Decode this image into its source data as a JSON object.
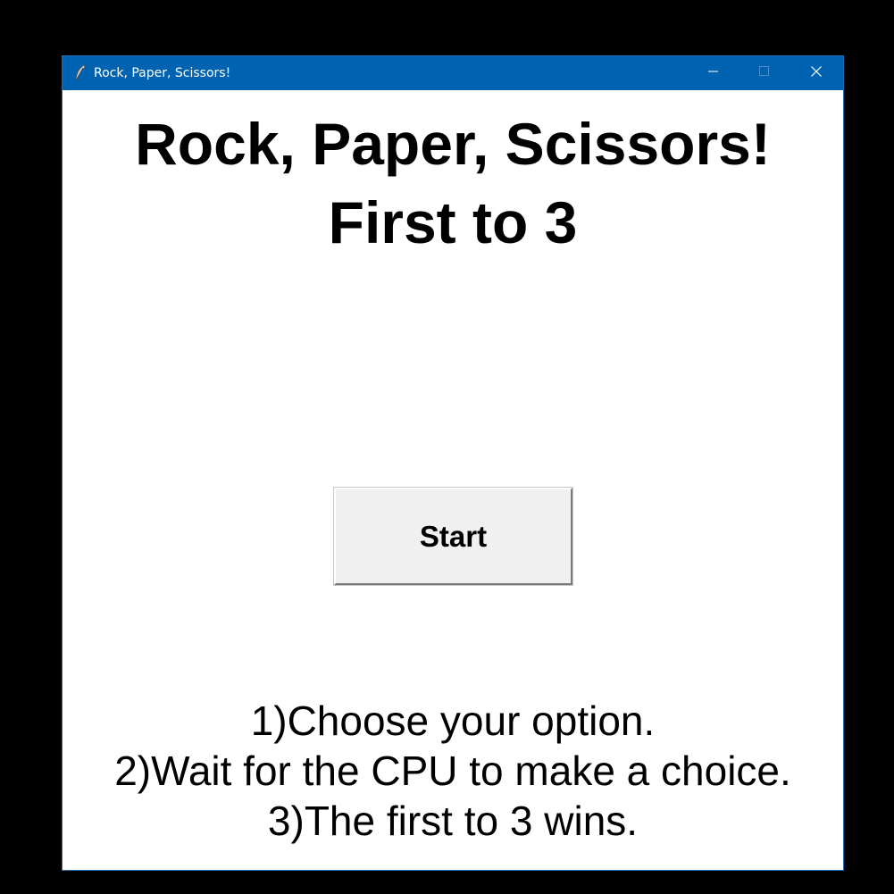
{
  "window": {
    "title": "Rock, Paper, Scissors!",
    "titlebar_color": "#0063b1",
    "controls": {
      "minimize_icon": "minimize-icon",
      "maximize_icon": "maximize-icon",
      "close_icon": "close-icon"
    }
  },
  "main": {
    "title_line1": "Rock, Paper, Scissors!",
    "title_line2": "First to 3",
    "start_label": "Start",
    "instructions": [
      "1)Choose your option.",
      "2)Wait for the CPU to make a choice.",
      "3)The first to 3 wins."
    ]
  }
}
